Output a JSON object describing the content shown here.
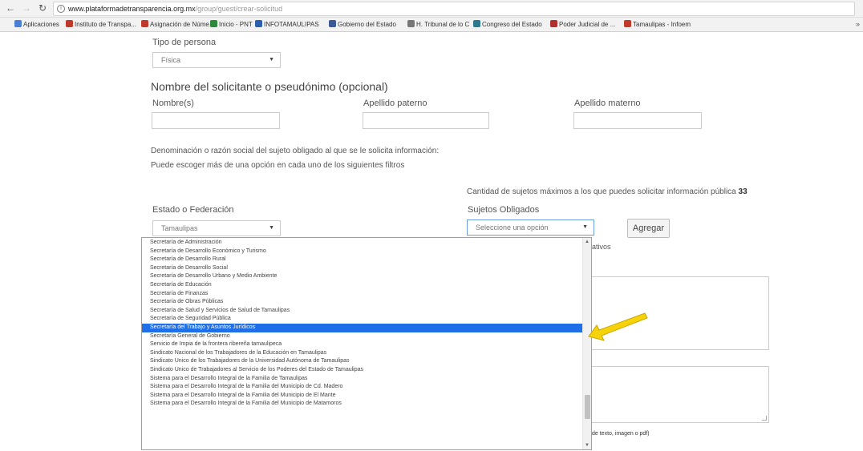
{
  "browser": {
    "url_domain": "www.plataformadetransparencia.org.mx",
    "url_path": "/group/guest/crear-solicitud",
    "bookmarks": [
      {
        "label": "Aplicaciones",
        "color": "#4a7fd6"
      },
      {
        "label": "Instituto de Transpa...",
        "color": "#c0392b"
      },
      {
        "label": "Asignación de Núme...",
        "color": "#c0392b"
      },
      {
        "label": "Inicio - PNT",
        "color": "#2c8a3c"
      },
      {
        "label": "INFOTAMAULIPAS",
        "color": "#2b5fb0"
      },
      {
        "label": "Gobierno del Estado",
        "color": "#3b5998"
      },
      {
        "label": "H. Tribunal de lo C",
        "color": "#777777"
      },
      {
        "label": "Congreso del Estado",
        "color": "#2a7b8f"
      },
      {
        "label": "Poder Judicial de ...",
        "color": "#b03030"
      },
      {
        "label": "Tamaulipas - Infoem",
        "color": "#c0392b"
      }
    ]
  },
  "form": {
    "tipo_persona_label": "Tipo de persona",
    "tipo_persona_value": "Física",
    "solicitante_heading": "Nombre del solicitante o pseudónimo (opcional)",
    "nombre_label": "Nombre(s)",
    "apellido_paterno_label": "Apellido paterno",
    "apellido_materno_label": "Apellido materno",
    "denominacion_text": "Denominación o razón social del sujeto obligado al que se le solicita información:",
    "puede_text": "Puede escoger más de una opción en cada uno de los siguientes filtros",
    "cantidad_text": "Cantidad de sujetos máximos a los que puedes solicitar información pública",
    "cantidad_value": "33",
    "estado_label": "Estado o Federación",
    "estado_value": "Tamaulipas",
    "sujetos_label": "Sujetos Obligados",
    "sujetos_placeholder": "Seleccione una opción",
    "agregar_button": "Agregar",
    "partial_text_1": "ativos",
    "partial_text_2": "de texto, imagen o pdf)"
  },
  "dropdown": {
    "selected_index": 11,
    "items": [
      "Secretaría de Administración",
      "Secretaría de Desarrollo Económico y Turismo",
      "Secretaría de Desarrollo Rural",
      "Secretaría de Desarrollo Social",
      "Secretaría de Desarrollo Urbano y Medio Ambiente",
      "Secretaría de Educación",
      "Secretaría de Finanzas",
      "Secretaría de Obras Públicas",
      "Secretaría de Salud y Servicios de Salud de Tamaulipas",
      "Secretaría de Seguridad Pública",
      "Secretaría del Trabajo y Asuntos Jurídicos",
      "Secretaría General de Gobierno",
      "Servicio de Impia de la frontera ribereña tamaulipeca",
      "Sindicato Nacional de los Trabajadores de la Educación en Tamaulipas",
      "Sindicato Único de los Trabajadores de la Universidad Autónoma de Tamaulipas",
      "Sindicato Único de Trabajadores al Servicio de los Poderes del Estado de Tamaulipas",
      "Sistema para el Desarrollo Integral de la Familia de Tamaulipas",
      "Sistema para el Desarrollo Integral de la Familia del Municipio de Cd. Madero",
      "Sistema para el Desarrollo Integral de la Familia del Municipio de El Mante",
      "Sistema para el Desarrollo Integral de la Familia del Municipio de Matamoros"
    ]
  },
  "annotation": {
    "arrow_color": "#f5d20a",
    "arrow_stroke": "#c9a800"
  }
}
